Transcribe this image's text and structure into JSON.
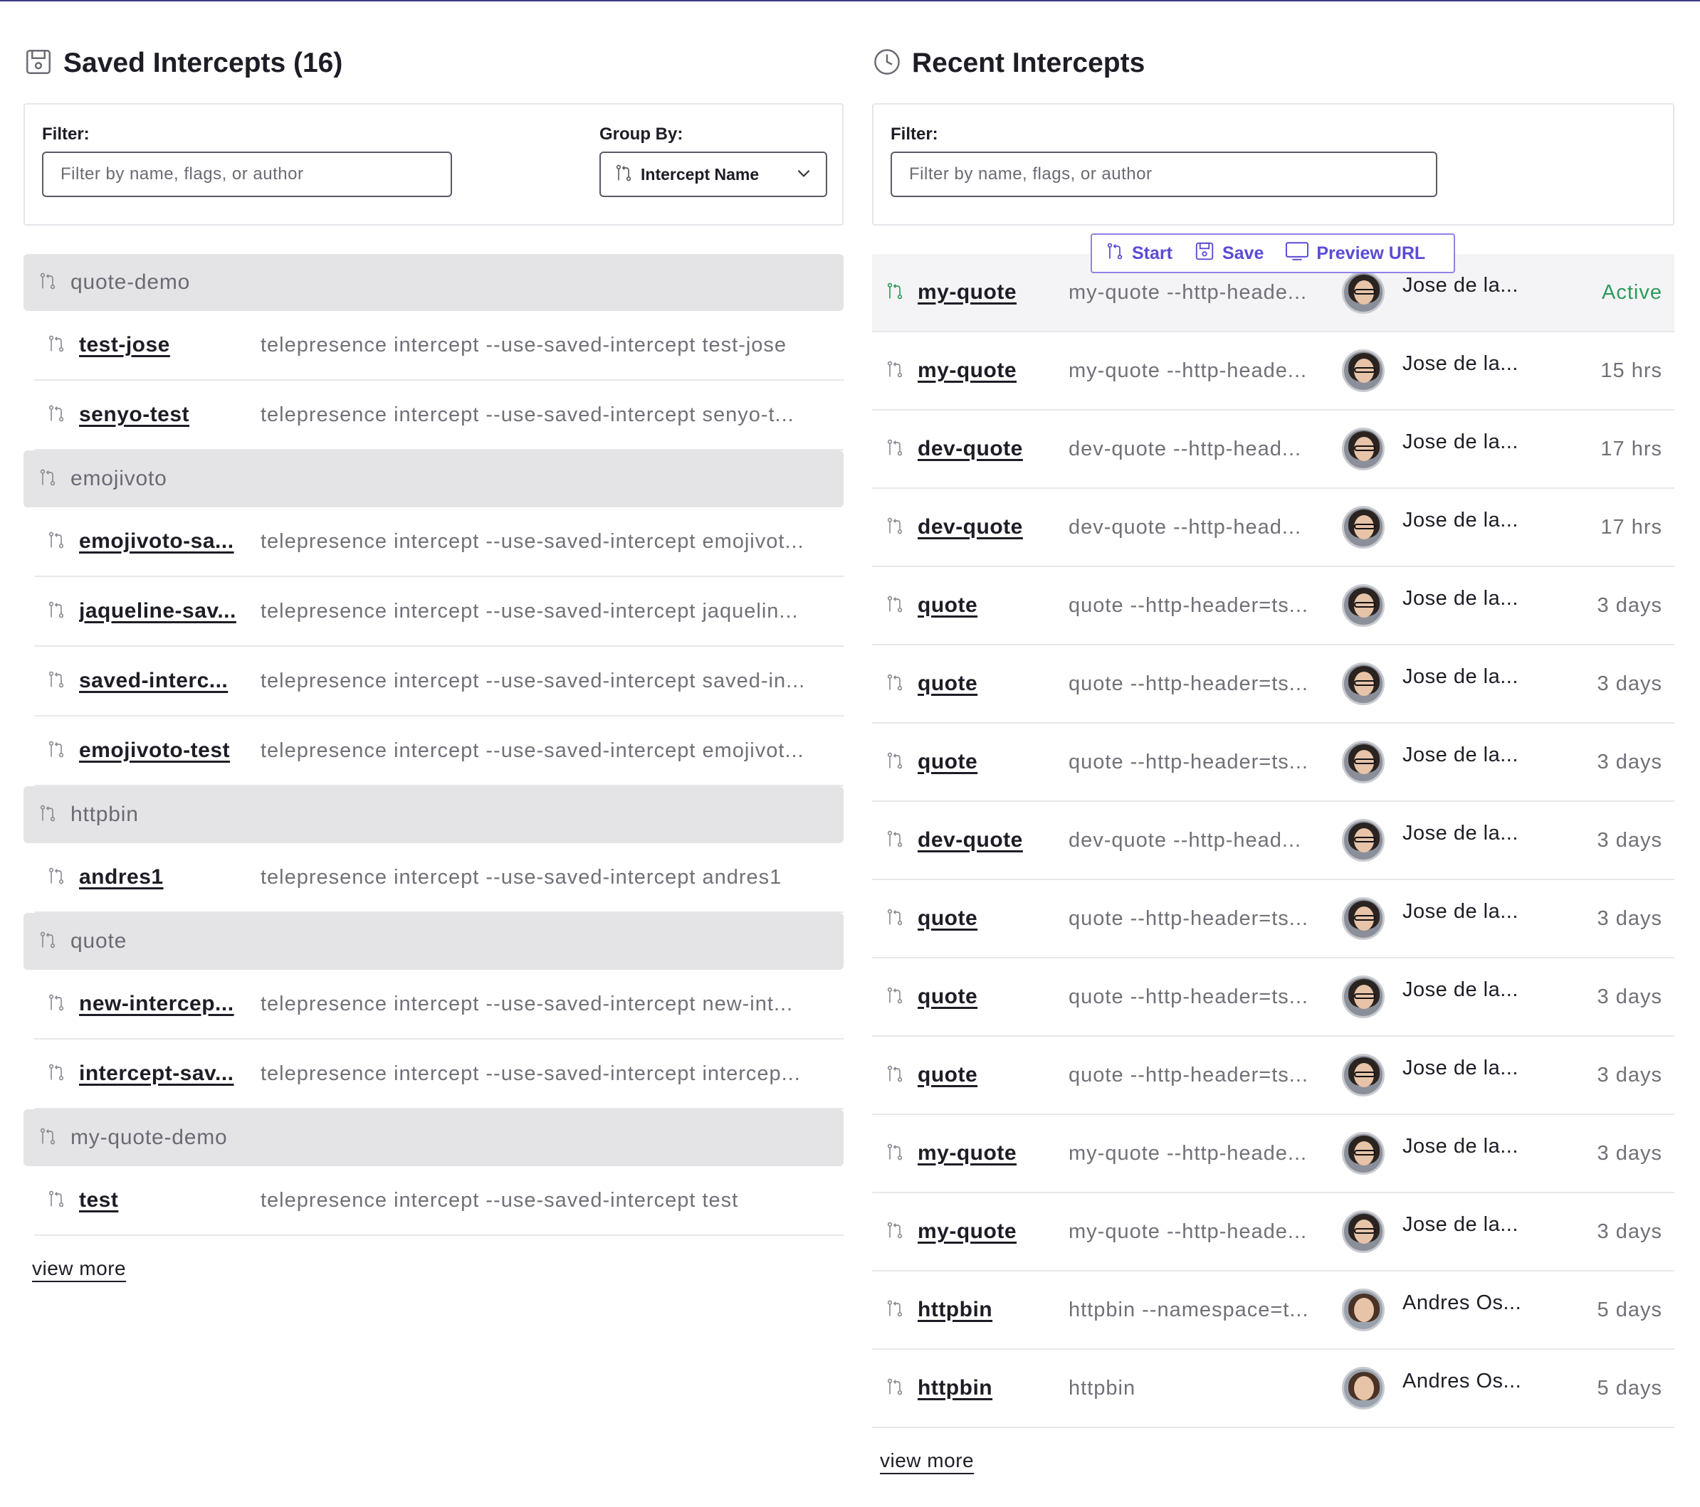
{
  "colors": {
    "accent": "#5a4bd6",
    "active": "#2e9a5c",
    "group_bg": "#e4e4e6",
    "top_line": "#3d3a82"
  },
  "saved": {
    "title": "Saved Intercepts (16)",
    "icon": "save-icon",
    "filter_label": "Filter:",
    "filter_placeholder": "Filter by name, flags, or author",
    "group_by_label": "Group By:",
    "group_by_value": "Intercept Name",
    "groups": [
      {
        "name": "quote-demo",
        "items": [
          {
            "name": "test-jose",
            "command": "telepresence intercept --use-saved-intercept test-jose"
          },
          {
            "name": "senyo-test",
            "command": "telepresence intercept --use-saved-intercept senyo-t..."
          }
        ]
      },
      {
        "name": "emojivoto",
        "items": [
          {
            "name": "emojivoto-sa...",
            "command": "telepresence intercept --use-saved-intercept emojivot..."
          },
          {
            "name": "jaqueline-sav...",
            "command": "telepresence intercept --use-saved-intercept jaquelin..."
          },
          {
            "name": "saved-interc...",
            "command": "telepresence intercept --use-saved-intercept saved-in..."
          },
          {
            "name": "emojivoto-test",
            "command": "telepresence intercept --use-saved-intercept emojivot..."
          }
        ]
      },
      {
        "name": "httpbin",
        "items": [
          {
            "name": "andres1",
            "command": "telepresence intercept --use-saved-intercept andres1"
          }
        ]
      },
      {
        "name": "quote",
        "items": [
          {
            "name": "new-intercep...",
            "command": "telepresence intercept --use-saved-intercept new-int..."
          },
          {
            "name": "intercept-sav...",
            "command": "telepresence intercept --use-saved-intercept intercep..."
          }
        ]
      },
      {
        "name": "my-quote-demo",
        "items": [
          {
            "name": "test",
            "command": "telepresence intercept --use-saved-intercept test"
          }
        ]
      }
    ],
    "view_more": "view more"
  },
  "recent": {
    "title": "Recent Intercepts",
    "icon": "clock-icon",
    "filter_label": "Filter:",
    "filter_placeholder": "Filter by name, flags, or author",
    "toolbar": {
      "start": "Start",
      "save": "Save",
      "preview": "Preview URL"
    },
    "rows": [
      {
        "name": "my-quote",
        "command": "my-quote --http-heade...",
        "author": "Jose de la...",
        "time": "Active",
        "active": true
      },
      {
        "name": "my-quote",
        "command": "my-quote --http-heade...",
        "author": "Jose de la...",
        "time": "15 hrs"
      },
      {
        "name": "dev-quote",
        "command": "dev-quote --http-head...",
        "author": "Jose de la...",
        "time": "17 hrs"
      },
      {
        "name": "dev-quote",
        "command": "dev-quote --http-head...",
        "author": "Jose de la...",
        "time": "17 hrs"
      },
      {
        "name": "quote",
        "command": "quote --http-header=ts...",
        "author": "Jose de la...",
        "time": "3 days"
      },
      {
        "name": "quote",
        "command": "quote --http-header=ts...",
        "author": "Jose de la...",
        "time": "3 days"
      },
      {
        "name": "quote",
        "command": "quote --http-header=ts...",
        "author": "Jose de la...",
        "time": "3 days"
      },
      {
        "name": "dev-quote",
        "command": "dev-quote --http-head...",
        "author": "Jose de la...",
        "time": "3 days"
      },
      {
        "name": "quote",
        "command": "quote --http-header=ts...",
        "author": "Jose de la...",
        "time": "3 days"
      },
      {
        "name": "quote",
        "command": "quote --http-header=ts...",
        "author": "Jose de la...",
        "time": "3 days"
      },
      {
        "name": "quote",
        "command": "quote --http-header=ts...",
        "author": "Jose de la...",
        "time": "3 days"
      },
      {
        "name": "my-quote",
        "command": "my-quote --http-heade...",
        "author": "Jose de la...",
        "time": "3 days"
      },
      {
        "name": "my-quote",
        "command": "my-quote --http-heade...",
        "author": "Jose de la...",
        "time": "3 days"
      },
      {
        "name": "httpbin",
        "command": "httpbin --namespace=t...",
        "author": "Andres Os...",
        "time": "5 days",
        "avatar": "b"
      },
      {
        "name": "httpbin",
        "command": "httpbin",
        "author": "Andres Os...",
        "time": "5 days",
        "avatar": "b"
      }
    ],
    "view_more": "view more"
  }
}
